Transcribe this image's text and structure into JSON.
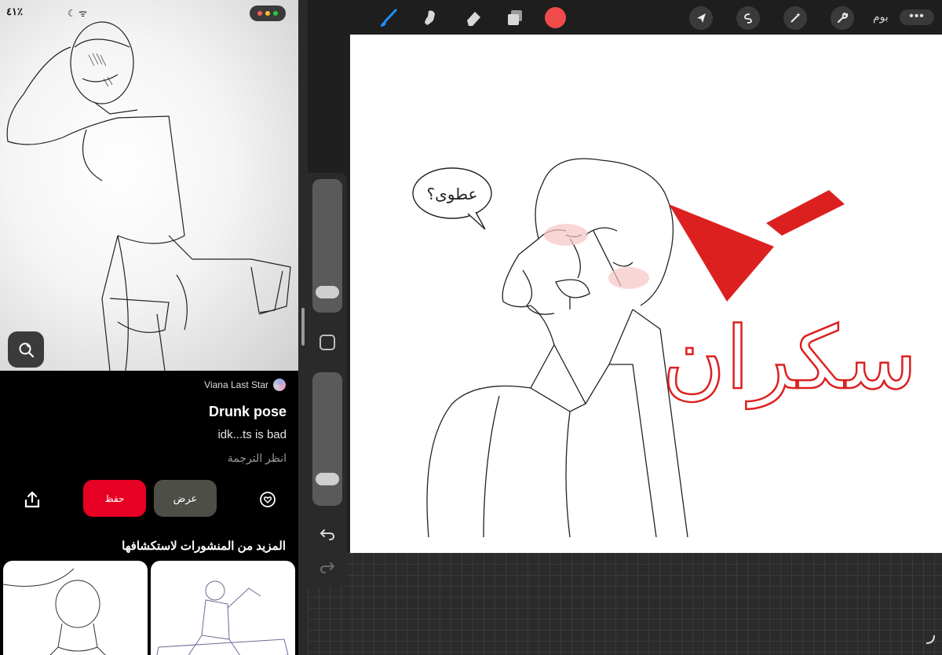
{
  "status_bar": {
    "text": "٤١٪",
    "icons": "☾ ᯤ",
    "dot_colors": [
      "#ff5f57",
      "#febc2e",
      "#28c840"
    ]
  },
  "pin": {
    "author": "Viana Last Star",
    "title": "Drunk pose",
    "description": "idk...ts is bad",
    "translate_link": "انظر الترجمة",
    "save_label": "حفظ",
    "view_label": "عرض",
    "more_heading": "المزيد من المنشورات لاستكشافها",
    "accent_color": "#e60023"
  },
  "procreate": {
    "gallery_label": "بوم",
    "more_label": "•••",
    "active_color": "#f04a4a",
    "tools": [
      "brush-icon",
      "smudge-icon",
      "eraser-icon",
      "layers-icon"
    ],
    "actions": [
      "cursor-icon",
      "selection-icon",
      "adjustments-icon",
      "wrench-icon"
    ]
  },
  "drawing": {
    "speech_bubble_text": "عطوى؟",
    "red_caption": "سكران",
    "ink_color": "#dc2020"
  }
}
